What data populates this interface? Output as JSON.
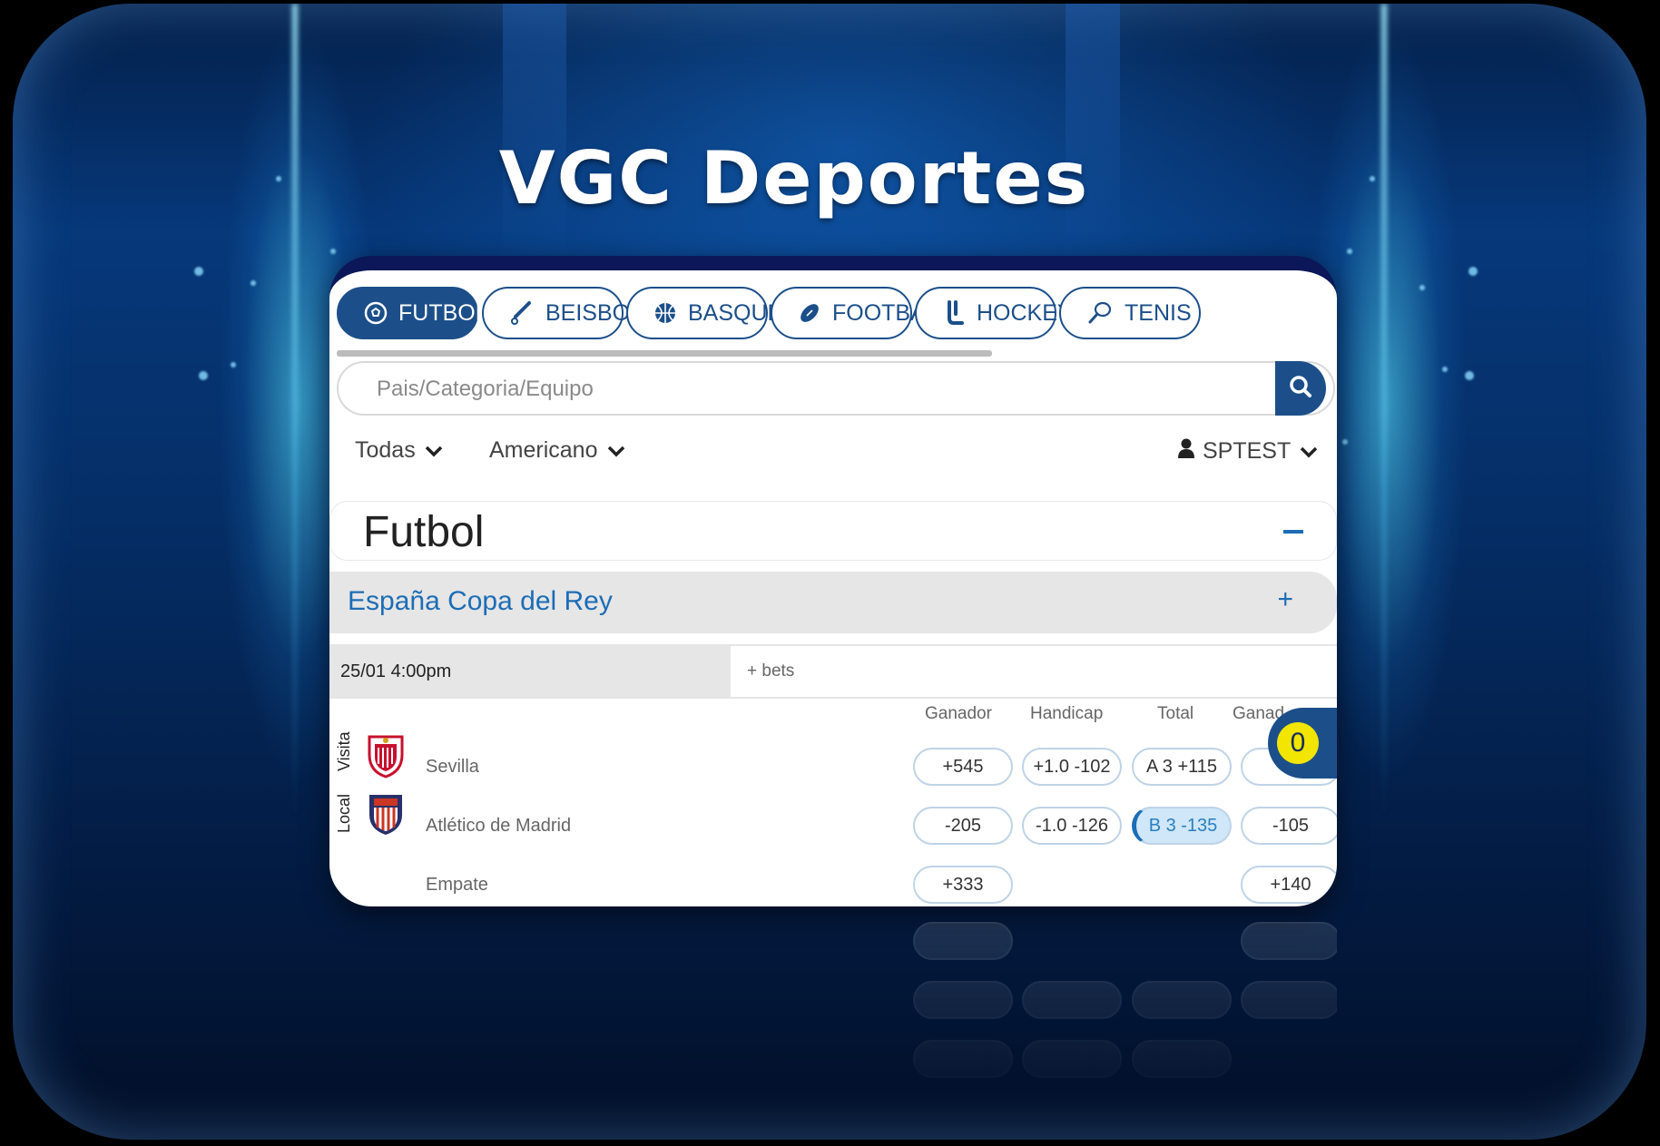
{
  "brand": {
    "title": "VGC Deportes"
  },
  "sports_tabs": [
    {
      "label": "FUTBOL",
      "icon": "soccer-ball-icon",
      "active": true
    },
    {
      "label": "BEISBOL",
      "icon": "baseball-bat-icon",
      "active": false
    },
    {
      "label": "BASQUET",
      "icon": "basketball-icon",
      "active": false
    },
    {
      "label": "FOOTBALL",
      "icon": "american-football-icon",
      "active": false
    },
    {
      "label": "HOCKEY",
      "icon": "hockey-stick-icon",
      "active": false
    },
    {
      "label": "TENIS",
      "icon": "tennis-racket-icon",
      "active": false
    }
  ],
  "search": {
    "placeholder": "Pais/Categoria/Equipo",
    "value": ""
  },
  "filters": {
    "period": "Todas",
    "odds_format": "Americano",
    "user": "SPTEST"
  },
  "section": {
    "title": "Futbol"
  },
  "league": {
    "name": "España Copa del Rey",
    "expand": "+"
  },
  "event": {
    "datetime": "25/01 4:00pm",
    "more_bets": "+ bets"
  },
  "columns": [
    "Ganador",
    "Handicap",
    "Total",
    "Ganad"
  ],
  "side_labels": {
    "away": "Visita",
    "home": "Local"
  },
  "rows": [
    {
      "team": "Sevilla",
      "logo": "sevilla-logo",
      "odds": [
        "+545",
        "+1.0 -102",
        "A 3 +115",
        ""
      ]
    },
    {
      "team": "Atlético de Madrid",
      "logo": "atletico-madrid-logo",
      "odds": [
        "-205",
        "-1.0 -126",
        "B 3 -135",
        "-105"
      ]
    },
    {
      "team": "Empate",
      "logo": "",
      "odds": [
        "+333",
        "",
        "",
        "+140"
      ]
    }
  ],
  "bet_slip": {
    "count": "0"
  },
  "colors": {
    "primary": "#1c4f8a",
    "accent": "#1c6db5",
    "badge": "#f2e500",
    "header_bar": "#0b1758"
  }
}
